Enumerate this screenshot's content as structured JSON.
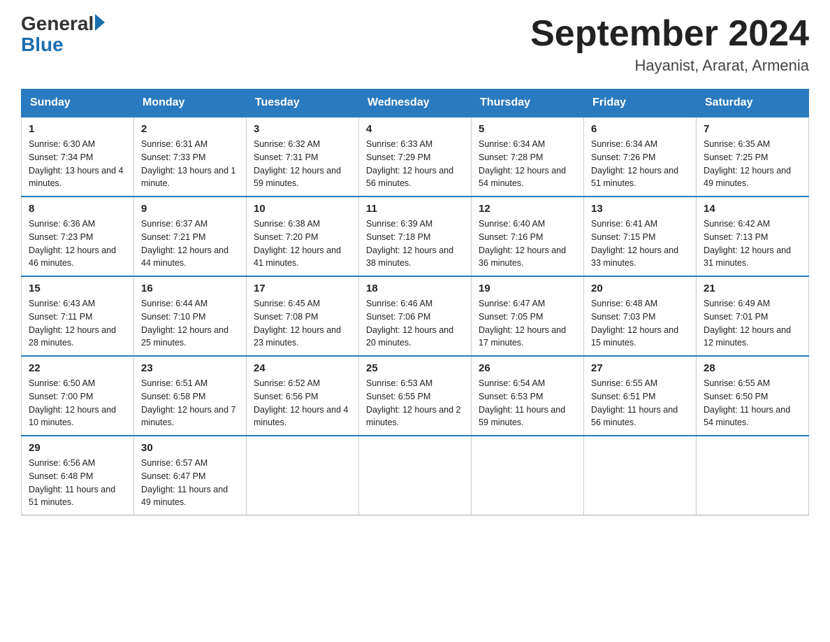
{
  "header": {
    "logo_general": "General",
    "logo_blue": "Blue",
    "month_title": "September 2024",
    "location": "Hayanist, Ararat, Armenia"
  },
  "days_of_week": [
    "Sunday",
    "Monday",
    "Tuesday",
    "Wednesday",
    "Thursday",
    "Friday",
    "Saturday"
  ],
  "weeks": [
    [
      {
        "day": "1",
        "sunrise": "Sunrise: 6:30 AM",
        "sunset": "Sunset: 7:34 PM",
        "daylight": "Daylight: 13 hours and 4 minutes."
      },
      {
        "day": "2",
        "sunrise": "Sunrise: 6:31 AM",
        "sunset": "Sunset: 7:33 PM",
        "daylight": "Daylight: 13 hours and 1 minute."
      },
      {
        "day": "3",
        "sunrise": "Sunrise: 6:32 AM",
        "sunset": "Sunset: 7:31 PM",
        "daylight": "Daylight: 12 hours and 59 minutes."
      },
      {
        "day": "4",
        "sunrise": "Sunrise: 6:33 AM",
        "sunset": "Sunset: 7:29 PM",
        "daylight": "Daylight: 12 hours and 56 minutes."
      },
      {
        "day": "5",
        "sunrise": "Sunrise: 6:34 AM",
        "sunset": "Sunset: 7:28 PM",
        "daylight": "Daylight: 12 hours and 54 minutes."
      },
      {
        "day": "6",
        "sunrise": "Sunrise: 6:34 AM",
        "sunset": "Sunset: 7:26 PM",
        "daylight": "Daylight: 12 hours and 51 minutes."
      },
      {
        "day": "7",
        "sunrise": "Sunrise: 6:35 AM",
        "sunset": "Sunset: 7:25 PM",
        "daylight": "Daylight: 12 hours and 49 minutes."
      }
    ],
    [
      {
        "day": "8",
        "sunrise": "Sunrise: 6:36 AM",
        "sunset": "Sunset: 7:23 PM",
        "daylight": "Daylight: 12 hours and 46 minutes."
      },
      {
        "day": "9",
        "sunrise": "Sunrise: 6:37 AM",
        "sunset": "Sunset: 7:21 PM",
        "daylight": "Daylight: 12 hours and 44 minutes."
      },
      {
        "day": "10",
        "sunrise": "Sunrise: 6:38 AM",
        "sunset": "Sunset: 7:20 PM",
        "daylight": "Daylight: 12 hours and 41 minutes."
      },
      {
        "day": "11",
        "sunrise": "Sunrise: 6:39 AM",
        "sunset": "Sunset: 7:18 PM",
        "daylight": "Daylight: 12 hours and 38 minutes."
      },
      {
        "day": "12",
        "sunrise": "Sunrise: 6:40 AM",
        "sunset": "Sunset: 7:16 PM",
        "daylight": "Daylight: 12 hours and 36 minutes."
      },
      {
        "day": "13",
        "sunrise": "Sunrise: 6:41 AM",
        "sunset": "Sunset: 7:15 PM",
        "daylight": "Daylight: 12 hours and 33 minutes."
      },
      {
        "day": "14",
        "sunrise": "Sunrise: 6:42 AM",
        "sunset": "Sunset: 7:13 PM",
        "daylight": "Daylight: 12 hours and 31 minutes."
      }
    ],
    [
      {
        "day": "15",
        "sunrise": "Sunrise: 6:43 AM",
        "sunset": "Sunset: 7:11 PM",
        "daylight": "Daylight: 12 hours and 28 minutes."
      },
      {
        "day": "16",
        "sunrise": "Sunrise: 6:44 AM",
        "sunset": "Sunset: 7:10 PM",
        "daylight": "Daylight: 12 hours and 25 minutes."
      },
      {
        "day": "17",
        "sunrise": "Sunrise: 6:45 AM",
        "sunset": "Sunset: 7:08 PM",
        "daylight": "Daylight: 12 hours and 23 minutes."
      },
      {
        "day": "18",
        "sunrise": "Sunrise: 6:46 AM",
        "sunset": "Sunset: 7:06 PM",
        "daylight": "Daylight: 12 hours and 20 minutes."
      },
      {
        "day": "19",
        "sunrise": "Sunrise: 6:47 AM",
        "sunset": "Sunset: 7:05 PM",
        "daylight": "Daylight: 12 hours and 17 minutes."
      },
      {
        "day": "20",
        "sunrise": "Sunrise: 6:48 AM",
        "sunset": "Sunset: 7:03 PM",
        "daylight": "Daylight: 12 hours and 15 minutes."
      },
      {
        "day": "21",
        "sunrise": "Sunrise: 6:49 AM",
        "sunset": "Sunset: 7:01 PM",
        "daylight": "Daylight: 12 hours and 12 minutes."
      }
    ],
    [
      {
        "day": "22",
        "sunrise": "Sunrise: 6:50 AM",
        "sunset": "Sunset: 7:00 PM",
        "daylight": "Daylight: 12 hours and 10 minutes."
      },
      {
        "day": "23",
        "sunrise": "Sunrise: 6:51 AM",
        "sunset": "Sunset: 6:58 PM",
        "daylight": "Daylight: 12 hours and 7 minutes."
      },
      {
        "day": "24",
        "sunrise": "Sunrise: 6:52 AM",
        "sunset": "Sunset: 6:56 PM",
        "daylight": "Daylight: 12 hours and 4 minutes."
      },
      {
        "day": "25",
        "sunrise": "Sunrise: 6:53 AM",
        "sunset": "Sunset: 6:55 PM",
        "daylight": "Daylight: 12 hours and 2 minutes."
      },
      {
        "day": "26",
        "sunrise": "Sunrise: 6:54 AM",
        "sunset": "Sunset: 6:53 PM",
        "daylight": "Daylight: 11 hours and 59 minutes."
      },
      {
        "day": "27",
        "sunrise": "Sunrise: 6:55 AM",
        "sunset": "Sunset: 6:51 PM",
        "daylight": "Daylight: 11 hours and 56 minutes."
      },
      {
        "day": "28",
        "sunrise": "Sunrise: 6:55 AM",
        "sunset": "Sunset: 6:50 PM",
        "daylight": "Daylight: 11 hours and 54 minutes."
      }
    ],
    [
      {
        "day": "29",
        "sunrise": "Sunrise: 6:56 AM",
        "sunset": "Sunset: 6:48 PM",
        "daylight": "Daylight: 11 hours and 51 minutes."
      },
      {
        "day": "30",
        "sunrise": "Sunrise: 6:57 AM",
        "sunset": "Sunset: 6:47 PM",
        "daylight": "Daylight: 11 hours and 49 minutes."
      },
      null,
      null,
      null,
      null,
      null
    ]
  ]
}
